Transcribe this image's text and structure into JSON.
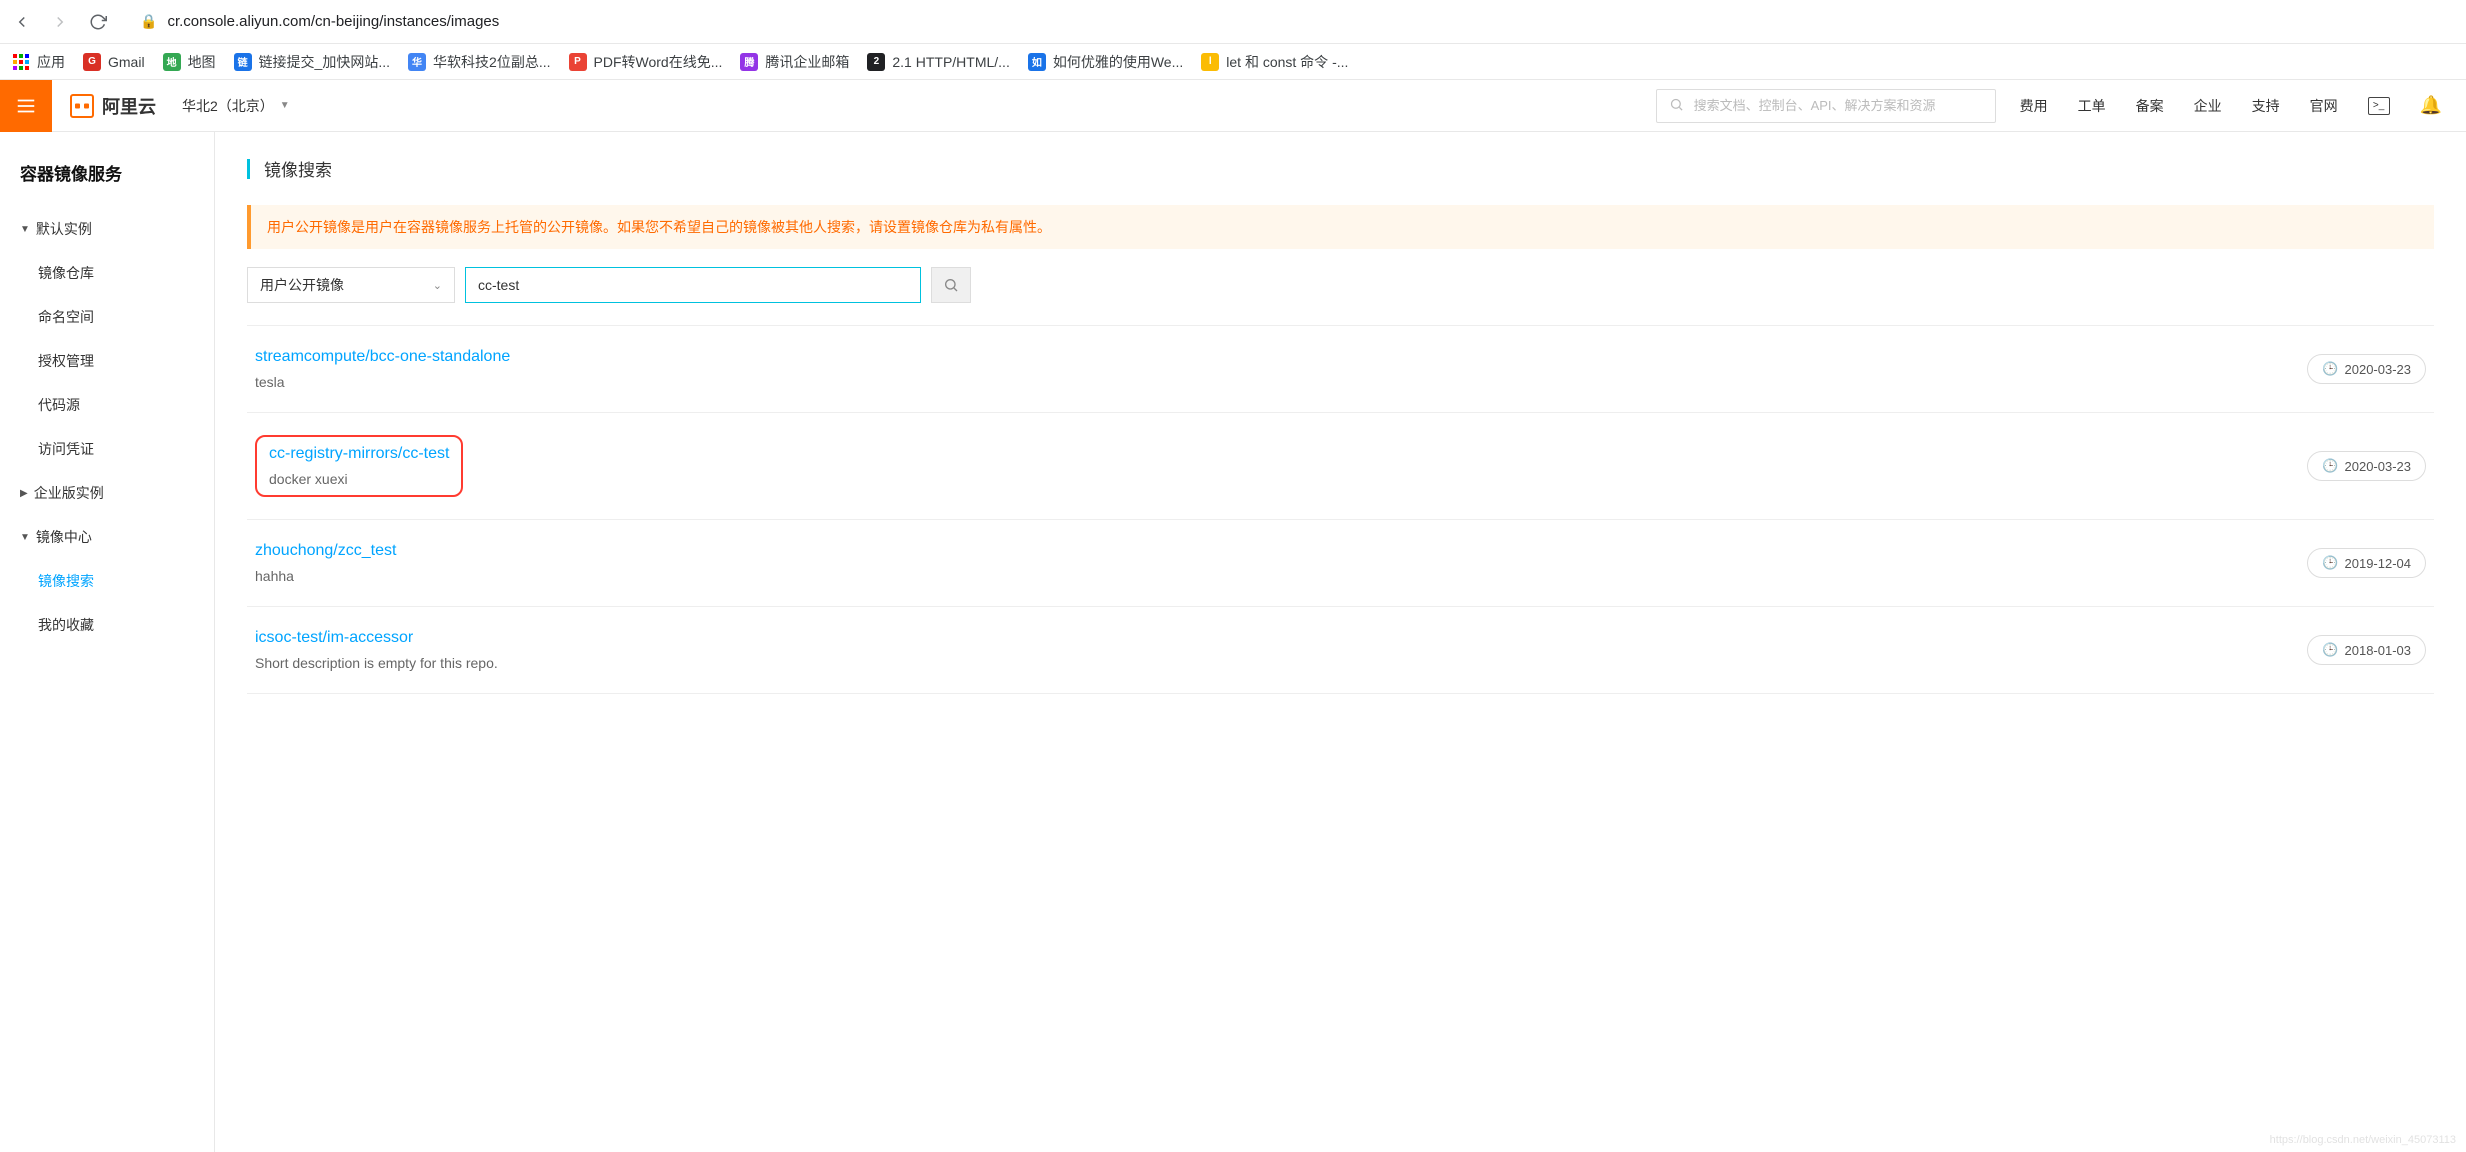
{
  "browser": {
    "url": "cr.console.aliyun.com/cn-beijing/instances/images"
  },
  "bookmarks": {
    "apps": "应用",
    "items": [
      {
        "label": "Gmail"
      },
      {
        "label": "地图"
      },
      {
        "label": "链接提交_加快网站..."
      },
      {
        "label": "华软科技2位副总..."
      },
      {
        "label": "PDF转Word在线免..."
      },
      {
        "label": "腾讯企业邮箱"
      },
      {
        "label": "2.1 HTTP/HTML/..."
      },
      {
        "label": "如何优雅的使用We..."
      },
      {
        "label": "let 和 const 命令 -..."
      }
    ]
  },
  "header": {
    "brand": "阿里云",
    "region": "华北2（北京）",
    "search_placeholder": "搜索文档、控制台、API、解决方案和资源",
    "nav": [
      "费用",
      "工单",
      "备案",
      "企业",
      "支持",
      "官网"
    ]
  },
  "sidebar": {
    "title": "容器镜像服务",
    "group_default": "默认实例",
    "items_default": [
      "镜像仓库",
      "命名空间",
      "授权管理",
      "代码源",
      "访问凭证"
    ],
    "group_enterprise": "企业版实例",
    "group_center": "镜像中心",
    "items_center": [
      "镜像搜索",
      "我的收藏"
    ],
    "active": "镜像搜索"
  },
  "page": {
    "title": "镜像搜索",
    "notice": "用户公开镜像是用户在容器镜像服务上托管的公开镜像。如果您不希望自己的镜像被其他人搜索，请设置镜像仓库为私有属性。",
    "filter_label": "用户公开镜像",
    "search_value": "cc-test"
  },
  "results": [
    {
      "title": "streamcompute/bcc-one-standalone",
      "desc": "tesla",
      "date": "2020-03-23",
      "highlight": false
    },
    {
      "title": "cc-registry-mirrors/cc-test",
      "desc": "docker xuexi",
      "date": "2020-03-23",
      "highlight": true
    },
    {
      "title": "zhouchong/zcc_test",
      "desc": "hahha",
      "date": "2019-12-04",
      "highlight": false
    },
    {
      "title": "icsoc-test/im-accessor",
      "desc": "Short description is empty for this repo.",
      "date": "2018-01-03",
      "highlight": false
    }
  ]
}
